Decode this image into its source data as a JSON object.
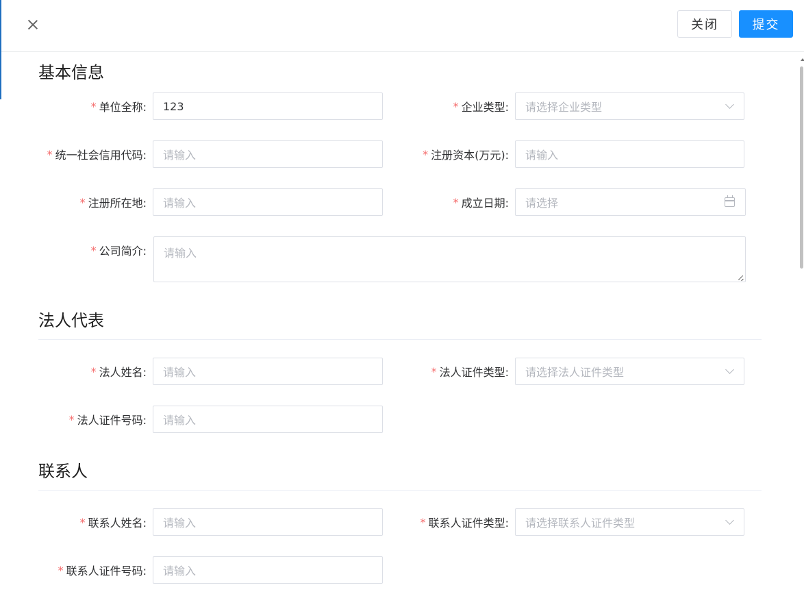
{
  "header": {
    "close_label": "关闭",
    "submit_label": "提交"
  },
  "sections": {
    "basic": {
      "title": "基本信息",
      "company_name": {
        "label": "单位全称:",
        "value": "123"
      },
      "company_type": {
        "label": "企业类型:",
        "placeholder": "请选择企业类型"
      },
      "credit_code": {
        "label": "统一社会信用代码:",
        "placeholder": "请输入"
      },
      "registered_capital": {
        "label": "注册资本(万元):",
        "placeholder": "请输入"
      },
      "registered_address": {
        "label": "注册所在地:",
        "placeholder": "请输入"
      },
      "established_date": {
        "label": "成立日期:",
        "placeholder": "请选择"
      },
      "company_intro": {
        "label": "公司简介:",
        "placeholder": "请输入"
      }
    },
    "legal": {
      "title": "法人代表",
      "name": {
        "label": "法人姓名:",
        "placeholder": "请输入"
      },
      "id_type": {
        "label": "法人证件类型:",
        "placeholder": "请选择法人证件类型"
      },
      "id_number": {
        "label": "法人证件号码:",
        "placeholder": "请输入"
      }
    },
    "contact": {
      "title": "联系人",
      "name": {
        "label": "联系人姓名:",
        "placeholder": "请输入"
      },
      "id_type": {
        "label": "联系人证件类型:",
        "placeholder": "请选择联系人证件类型"
      },
      "id_number": {
        "label": "联系人证件号码:",
        "placeholder": "请输入"
      }
    }
  },
  "required_mark": "*",
  "colors": {
    "primary": "#1890ff",
    "required": "#f56c6c",
    "border": "#dcdfe6",
    "placeholder": "#b5b8bf"
  },
  "icons": [
    "close-icon",
    "chevron-down-icon",
    "calendar-icon",
    "resize-handle-icon"
  ]
}
